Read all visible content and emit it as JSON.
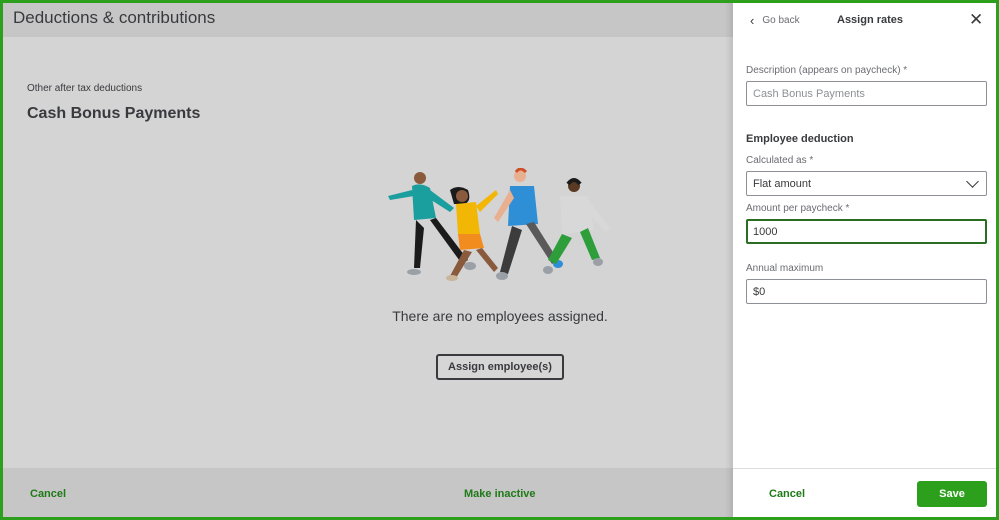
{
  "page": {
    "title": "Deductions & contributions",
    "category_label": "Other after tax deductions",
    "item_title": "Cash Bonus Payments",
    "empty_state_text": "There are no employees assigned.",
    "assign_button_label": "Assign employee(s)",
    "footer": {
      "cancel_label": "Cancel",
      "make_inactive_label": "Make inactive"
    }
  },
  "drawer": {
    "go_back_label": "Go back",
    "title": "Assign rates",
    "close_icon": "close-icon",
    "description_label": "Description (appears on paycheck) *",
    "description_placeholder": "Cash Bonus Payments",
    "section_title": "Employee deduction",
    "calculated_as_label": "Calculated as *",
    "calculated_as_value": "Flat amount",
    "amount_label": "Amount per paycheck *",
    "amount_value": "1000",
    "annual_max_label": "Annual maximum",
    "annual_max_value": "$0",
    "footer": {
      "cancel_label": "Cancel",
      "save_label": "Save"
    }
  },
  "colors": {
    "accent_green": "#2ca01c",
    "link_green": "#1f7a17",
    "overlay_gray": "#d4d4d5"
  }
}
